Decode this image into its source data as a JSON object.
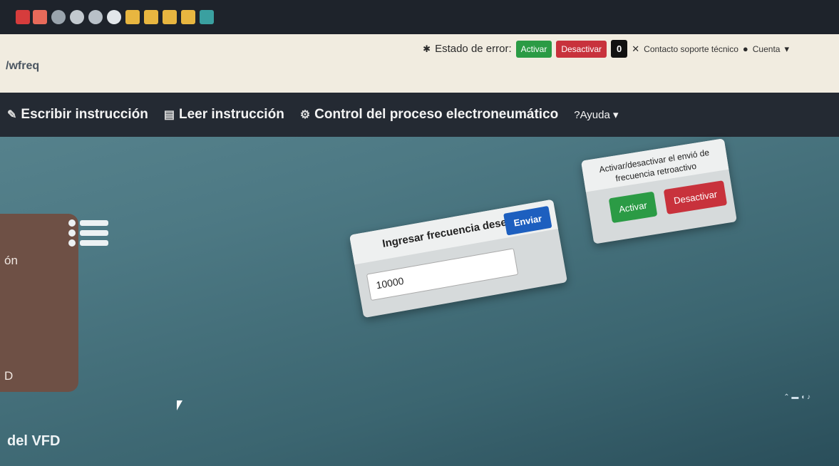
{
  "header": {
    "brand": "/wfreq",
    "status_label": "Estado de error:",
    "activate_label": "Activar",
    "deactivate_label": "Desactivar",
    "error_count": "0",
    "support_label": "Contacto soporte técnico",
    "account_label": "Cuenta"
  },
  "nav": {
    "items": [
      {
        "label": "Escribir instrucción",
        "icon": "edit-icon"
      },
      {
        "label": "Leer instrucción",
        "icon": "document-icon"
      },
      {
        "label": "Control del proceso electroneumático",
        "icon": "gears-icon"
      },
      {
        "label": "Ayuda",
        "icon": "question-icon"
      }
    ]
  },
  "sidebar": {
    "label_top": "ón",
    "label_mid": "D",
    "label_bottom": "del VFD"
  },
  "frequency_card": {
    "title": "Ingresar frecuencia deseada",
    "input_value": "10000",
    "send_label": "Enviar"
  },
  "feedback_card": {
    "title": "Activar/desactivar el envió de frecuencia retroactivo",
    "activate_label": "Activar",
    "deactivate_label": "Desactivar"
  },
  "colors": {
    "green": "#2b9b45",
    "red": "#c8323c",
    "blue": "#1d5fbf",
    "nav": "#242a33",
    "topbar": "#f1ece0"
  }
}
